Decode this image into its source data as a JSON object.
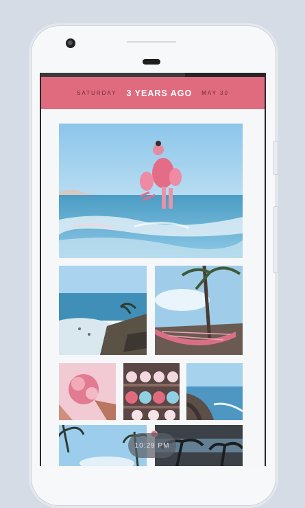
{
  "header": {
    "day": "SATURDAY",
    "title": "3 YEARS AGO",
    "date": "MAY 30"
  },
  "timestamp": "10:29 PM",
  "colors": {
    "accent": "#e06b7f",
    "page_background": "#d6dce6",
    "screen_background": "#f6f7f9"
  },
  "photos": [
    {
      "id": "photo-beach-child-hero",
      "subject": "child with floaties at beach shore"
    },
    {
      "id": "photo-coast-aerial",
      "subject": "beach coastline with palm tree"
    },
    {
      "id": "photo-hammock-palms",
      "subject": "hammock under palm trees"
    },
    {
      "id": "photo-flowers",
      "subject": "pink flowers held in hands"
    },
    {
      "id": "photo-sugar-skulls",
      "subject": "painted sugar skulls on shelves"
    },
    {
      "id": "photo-cliff-ocean",
      "subject": "coastal cliff and ocean"
    },
    {
      "id": "photo-palms-sky",
      "subject": "palm trees against sky"
    },
    {
      "id": "photo-dark-palms",
      "subject": "palm silhouettes at dusk"
    }
  ]
}
